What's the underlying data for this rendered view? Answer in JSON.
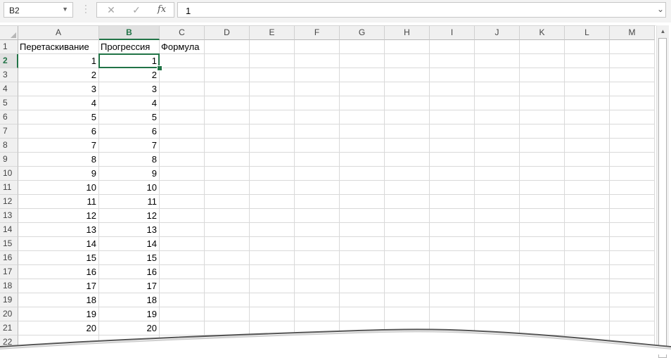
{
  "formula_bar": {
    "name_box": "B2",
    "cancel_icon": "✕",
    "enter_icon": "✓",
    "function_label": "fx",
    "formula_value": "1"
  },
  "columns": [
    "A",
    "B",
    "C",
    "D",
    "E",
    "F",
    "G",
    "H",
    "I",
    "J",
    "K",
    "L",
    "M"
  ],
  "selected_column": "B",
  "rows": [
    "1",
    "2",
    "3",
    "4",
    "5",
    "6",
    "7",
    "8",
    "9",
    "10",
    "11",
    "12",
    "13",
    "14",
    "15",
    "16",
    "17",
    "18",
    "19",
    "20",
    "21",
    "22"
  ],
  "selected_row": "2",
  "headers": {
    "A": "Перетаскивание",
    "B": "Прогрессия",
    "C": "Формула"
  },
  "col_a_values": [
    "1",
    "2",
    "3",
    "4",
    "5",
    "6",
    "7",
    "8",
    "9",
    "10",
    "11",
    "12",
    "13",
    "14",
    "15",
    "16",
    "17",
    "18",
    "19",
    "20"
  ],
  "col_b_values": [
    "1",
    "2",
    "3",
    "4",
    "5",
    "6",
    "7",
    "8",
    "9",
    "10",
    "11",
    "12",
    "13",
    "14",
    "15",
    "16",
    "17",
    "18",
    "19",
    "20"
  ],
  "colors": {
    "accent": "#217346",
    "grid_line": "#d9d9d9",
    "header_bg": "#f0f0f0"
  },
  "icons": {
    "name_box_dropdown": "chevron-down-icon",
    "menu_dots": "vertical-dots-icon",
    "cancel": "close-icon",
    "enter": "check-icon",
    "function": "function-icon",
    "expand": "chevron-down-icon",
    "scroll_up": "arrow-up-icon"
  }
}
